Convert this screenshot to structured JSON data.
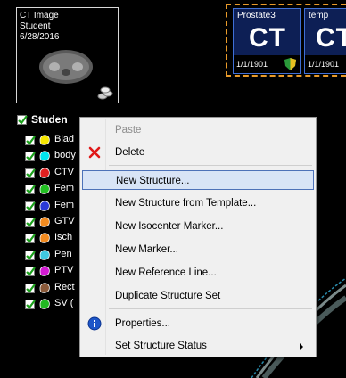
{
  "thumbnail": {
    "lines": [
      "CT Image",
      "Student",
      "6/28/2016"
    ]
  },
  "series": [
    {
      "name": "Prostate3",
      "modality": "CT",
      "date": "1/1/1901"
    },
    {
      "name": "temp",
      "modality": "CT",
      "date": "1/1/1901"
    }
  ],
  "structure_set": {
    "label": "Studen"
  },
  "structures": [
    {
      "label": "Blad",
      "color": "#f5e600"
    },
    {
      "label": "body",
      "color": "#00e5ee"
    },
    {
      "label": "CTV",
      "color": "#e02020"
    },
    {
      "label": "Fem",
      "color": "#22c022"
    },
    {
      "label": "Fem",
      "color": "#2a3ad8"
    },
    {
      "label": "GTV",
      "color": "#f08a20"
    },
    {
      "label": "Isch",
      "color": "#f08a20"
    },
    {
      "label": "Pen",
      "color": "#40c8e0"
    },
    {
      "label": "PTV",
      "color": "#d21bd2"
    },
    {
      "label": "Rect",
      "color": "#8a5a3a"
    },
    {
      "label": "SV (",
      "color": "#22b822"
    }
  ],
  "menu": {
    "items": [
      {
        "label": "Paste",
        "enabled": false
      },
      {
        "label": "Delete",
        "icon": "delete-x-icon"
      },
      {
        "label": "New Structure...",
        "highlighted": true
      },
      {
        "label": "New Structure from Template..."
      },
      {
        "label": "New Isocenter Marker..."
      },
      {
        "label": "New Marker..."
      },
      {
        "label": "New Reference Line..."
      },
      {
        "label": "Duplicate Structure Set"
      },
      {
        "label": "Properties...",
        "icon": "info-icon"
      },
      {
        "label": "Set Structure Status",
        "submenu": true
      }
    ]
  },
  "colors": {
    "series_border": "#e89a2a",
    "tile_bg": "#0d1f55",
    "menu_highlight": "#d8e4f6",
    "delete_red": "#e01818",
    "info_blue": "#1d56c8"
  }
}
